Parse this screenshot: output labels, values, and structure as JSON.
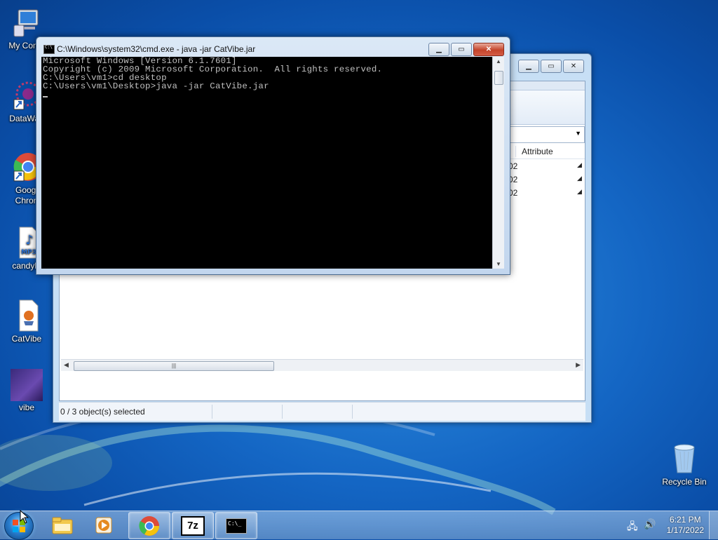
{
  "desktop": {
    "icons": [
      {
        "label": "My Comp"
      },
      {
        "label": "DataWag"
      },
      {
        "label": "Googl\nChron"
      },
      {
        "label": "candyla"
      },
      {
        "label": "CatVibe"
      },
      {
        "label": "vibe"
      }
    ],
    "recycle_bin": {
      "label": "Recycle Bin"
    },
    "mp3_badge": "MP3"
  },
  "explorer": {
    "column_header": "Attribute",
    "rows": [
      "02",
      "02",
      "02"
    ],
    "status_text": "0 / 3 object(s) selected"
  },
  "cmd_window": {
    "title": "C:\\Windows\\system32\\cmd.exe - java  -jar CatVibe.jar",
    "lines": [
      "Microsoft Windows [Version 6.1.7601]",
      "Copyright (c) 2009 Microsoft Corporation.  All rights reserved.",
      "",
      "C:\\Users\\vm1>cd desktop",
      "",
      "C:\\Users\\vm1\\Desktop>java -jar CatVibe.jar"
    ]
  },
  "taskbar": {
    "items": [
      {
        "name": "windows-explorer",
        "active": false
      },
      {
        "name": "media-player",
        "active": false
      },
      {
        "name": "chrome",
        "active": true
      },
      {
        "name": "7zip",
        "active": true,
        "label": "7z"
      },
      {
        "name": "cmd",
        "active": true
      }
    ],
    "clock": {
      "time": "6:21 PM",
      "date": "1/17/2022"
    }
  }
}
